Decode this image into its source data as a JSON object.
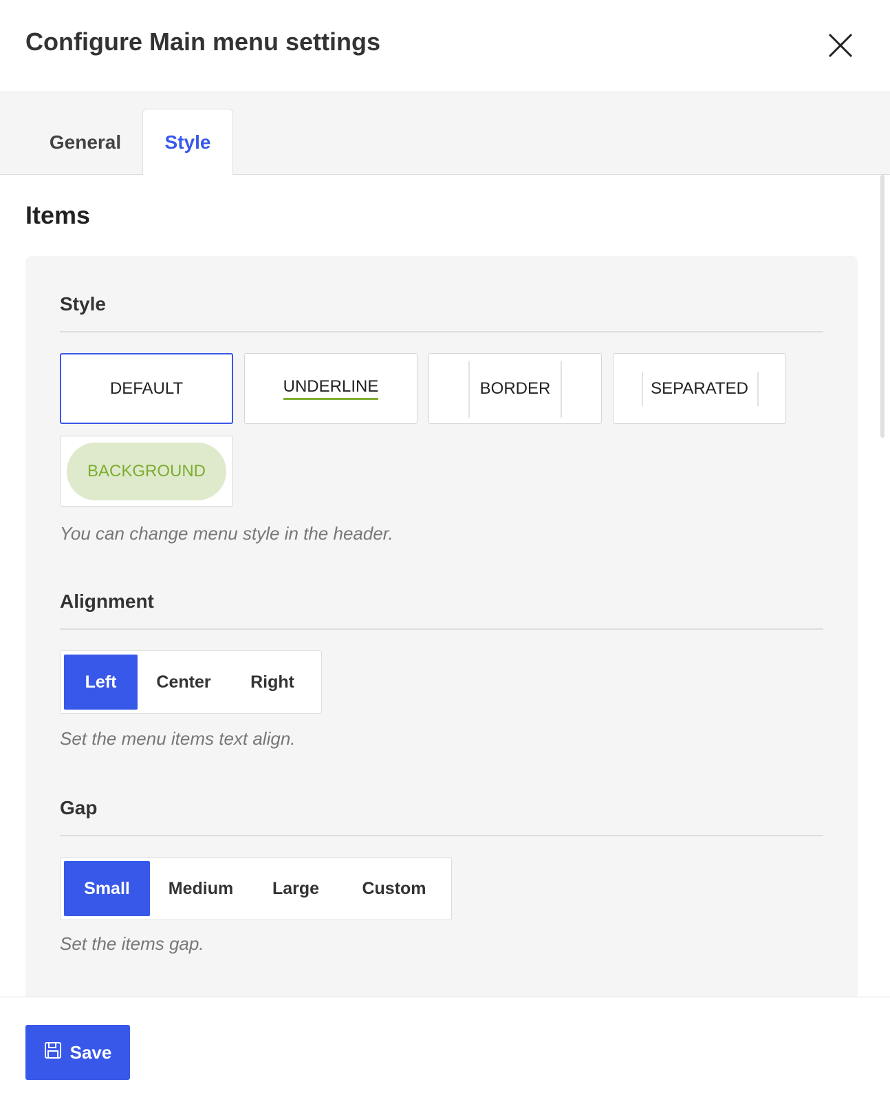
{
  "header": {
    "title": "Configure Main menu settings",
    "close_icon": "close-icon"
  },
  "tabs": [
    {
      "label": "General",
      "active": false
    },
    {
      "label": "Style",
      "active": true
    }
  ],
  "section": {
    "title": "Items"
  },
  "style_field": {
    "label": "Style",
    "options": [
      "DEFAULT",
      "UNDERLINE",
      "BORDER",
      "SEPARATED",
      "BACKGROUND"
    ],
    "selected": "DEFAULT",
    "help": "You can change menu style in the header."
  },
  "alignment_field": {
    "label": "Alignment",
    "options": [
      "Left",
      "Center",
      "Right"
    ],
    "selected": "Left",
    "help": "Set the menu items text align."
  },
  "gap_field": {
    "label": "Gap",
    "options": [
      "Small",
      "Medium",
      "Large",
      "Custom"
    ],
    "selected": "Small",
    "help": "Set the items gap."
  },
  "footer": {
    "save_label": "Save",
    "save_icon": "floppy-disk-icon"
  },
  "colors": {
    "accent": "#3858e9",
    "underline_green": "#7cad2f",
    "background_pill": "#dfeacd"
  }
}
